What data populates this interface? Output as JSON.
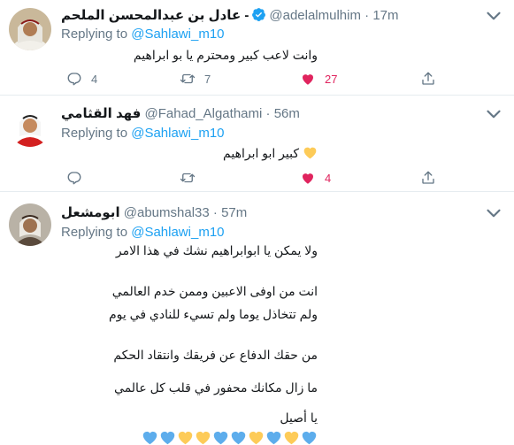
{
  "replying_label": "Replying to",
  "colors": {
    "accent": "#1da1f2",
    "like": "#e0245e",
    "muted": "#657786",
    "yellow_heart": "#fdcb58",
    "blue_heart": "#5dadec"
  },
  "tweets": [
    {
      "name": "عادل بن عبدالمحسن الملحم -",
      "verified": true,
      "handle": "@adelalmulhim",
      "time": "17m",
      "reply_to": "@Sahlawi_m10",
      "lines": [
        "وانت لاعب كبير ومحترم يا بو ابراهيم"
      ],
      "replies": "4",
      "retweets": "7",
      "likes": "27",
      "liked": true
    },
    {
      "name": "فهد القثامي",
      "verified": false,
      "handle": "@Fahad_Algathami",
      "time": "56m",
      "reply_to": "@Sahlawi_m10",
      "lines": [
        "كبير ابو ابراهيم"
      ],
      "emoji_after": "yellow-heart",
      "replies": "",
      "retweets": "",
      "likes": "4",
      "liked": true
    },
    {
      "name": "ابومشعل",
      "verified": false,
      "handle": "@abumshal33",
      "time": "57m",
      "reply_to": "@Sahlawi_m10",
      "lines": [
        "ولا يمكن يا ابوابراهيم نشك في هذا الامر",
        "انت من اوفى الاعبين وممن خدم العالمي",
        "ولم تتخاذل يوما ولم تسيء للنادي في يوم",
        "من حقك الدفاع عن فريقك وانتقاد الحكم",
        "ما زال مكانك محفور في قلب كل عالمي",
        "يا أصيل"
      ],
      "emoji_hearts": [
        "blue",
        "yellow",
        "blue",
        "yellow",
        "blue",
        "blue",
        "yellow",
        "yellow",
        "blue",
        "blue"
      ]
    }
  ]
}
